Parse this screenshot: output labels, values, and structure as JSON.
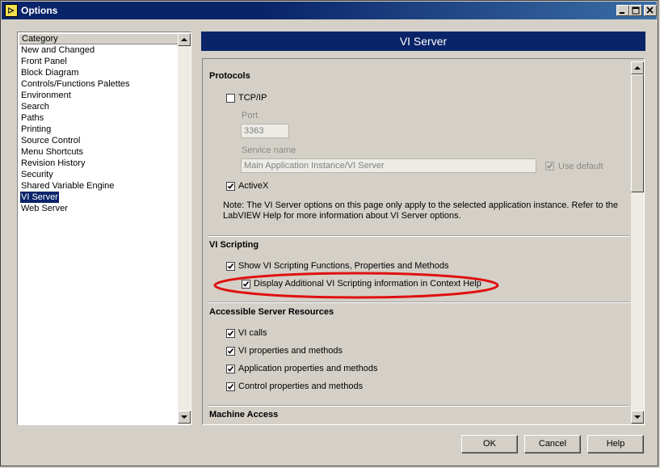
{
  "window": {
    "title": "Options"
  },
  "category_list": {
    "header": "Category",
    "items": [
      "New and Changed",
      "Front Panel",
      "Block Diagram",
      "Controls/Functions Palettes",
      "Environment",
      "Search",
      "Paths",
      "Printing",
      "Source Control",
      "Menu Shortcuts",
      "Revision History",
      "Security",
      "Shared Variable Engine",
      "VI Server",
      "Web Server"
    ],
    "selected": "VI Server"
  },
  "page": {
    "title": "VI Server",
    "protocols": {
      "title": "Protocols",
      "tcpip_label": "TCP/IP",
      "tcpip_checked": false,
      "port_label": "Port",
      "port_value": "3363",
      "service_name_label": "Service name",
      "service_name_value": "Main Application Instance/VI Server",
      "use_default_label": "Use default",
      "use_default_checked": true,
      "activex_label": "ActiveX",
      "activex_checked": true,
      "note": "Note: The VI Server options on this page only apply to the selected application instance. Refer to the LabVIEW Help for more information about VI Server options."
    },
    "vi_scripting": {
      "title": "VI Scripting",
      "show_label": "Show VI Scripting Functions, Properties and Methods",
      "show_checked": true,
      "display_label": "Display Additional VI Scripting information in Context Help",
      "display_checked": true
    },
    "accessible_resources": {
      "title": "Accessible Server Resources",
      "vi_calls_label": "VI calls",
      "vi_props_label": "VI properties and methods",
      "app_props_label": "Application properties and methods",
      "control_props_label": "Control properties and methods"
    },
    "machine_access": {
      "title": "Machine Access"
    },
    "annotation_color": "#e01010"
  },
  "buttons": {
    "ok": "OK",
    "cancel": "Cancel",
    "help": "Help"
  }
}
